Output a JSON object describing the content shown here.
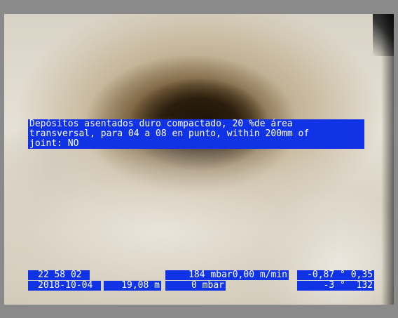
{
  "observation": {
    "line1": "Depósitos asentados duro compactado, 20 %de área",
    "line2": "transversal, para 04 a 08 en punto, within 200mm of",
    "line3": "joint: NO"
  },
  "telemetry": {
    "time": "22 58 02",
    "date": "2018-10-04",
    "distance": "19,08 m",
    "pressure_speed": "184 mbar0,00 m/min",
    "pressure2": "0 mbar",
    "incline_top": "-0,87 ° 0,35",
    "incline_bottom": "-3 °  132"
  },
  "colors": {
    "overlay_bg": "#1033e6",
    "overlay_text": "#ffffff",
    "frame": "#8a8a8a"
  }
}
